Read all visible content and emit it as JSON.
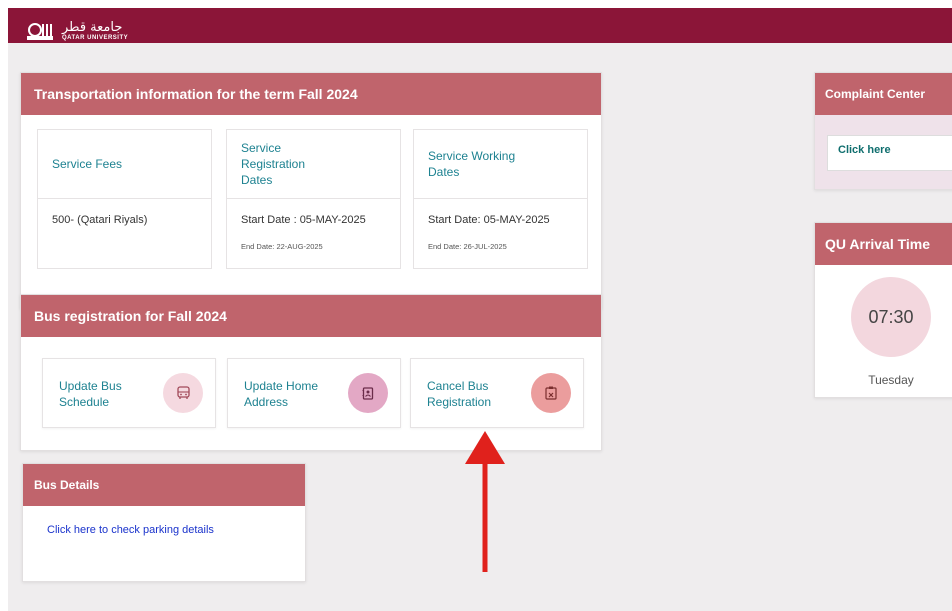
{
  "header": {
    "logo_arabic": "جامعة قطر",
    "logo_latin": "QATAR UNIVERSITY"
  },
  "transport": {
    "title": "Transportation information for the term Fall 2024",
    "boxes": [
      {
        "title": "Service Fees",
        "main": "500- (Qatari Riyals)",
        "sub": ""
      },
      {
        "title": "Service Registration Dates",
        "main": "Start Date : 05-MAY-2025",
        "sub": "End Date: 22-AUG-2025"
      },
      {
        "title": "Service Working Dates",
        "main": "Start Date: 05-MAY-2025",
        "sub": "End Date: 26-JUL-2025"
      }
    ]
  },
  "bus_registration": {
    "title": "Bus registration for Fall 2024",
    "actions": [
      {
        "label": "Update Bus Schedule",
        "icon": "bus-icon",
        "icon_bg": "#f5d9e0",
        "icon_color": "#a24a5a"
      },
      {
        "label": "Update Home Address",
        "icon": "address-book-icon",
        "icon_bg": "#e3a8c5",
        "icon_color": "#6b2c4a"
      },
      {
        "label": "Cancel Bus Registration",
        "icon": "clipboard-cancel-icon",
        "icon_bg": "#eb9d9d",
        "icon_color": "#7a2e2e"
      }
    ]
  },
  "bus_details": {
    "title": "Bus Details",
    "link": "Click here to check parking details"
  },
  "complaint": {
    "title": "Complaint Center",
    "link": "Click here"
  },
  "arrival": {
    "title": "QU Arrival Time",
    "time": "07:30",
    "day": "Tuesday"
  },
  "colors": {
    "brand": "#8b1538",
    "card_header": "#c0646c",
    "link_teal": "#1e8291",
    "annotation_arrow": "#e0211c"
  }
}
